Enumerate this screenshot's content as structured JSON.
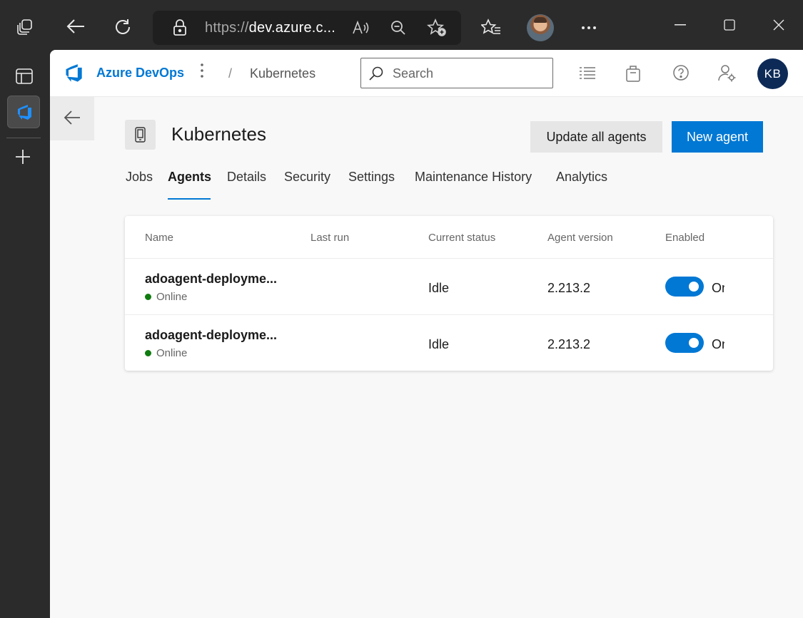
{
  "browser": {
    "url_prefix": "https://",
    "url_host": "dev.azure.c..."
  },
  "brand": {
    "name": "Azure DevOps",
    "color": "#0078d4"
  },
  "breadcrumb": {
    "separator": "/",
    "current": "Kubernetes"
  },
  "search": {
    "placeholder": "Search"
  },
  "user": {
    "initials": "KB"
  },
  "pool": {
    "title": "Kubernetes"
  },
  "actions": {
    "update_all": "Update all agents",
    "new_agent": "New agent"
  },
  "tabs": [
    {
      "label": "Jobs",
      "active": false
    },
    {
      "label": "Agents",
      "active": true
    },
    {
      "label": "Details",
      "active": false
    },
    {
      "label": "Security",
      "active": false
    },
    {
      "label": "Settings",
      "active": false
    },
    {
      "label": "Maintenance History",
      "active": false
    },
    {
      "label": "Analytics",
      "active": false
    }
  ],
  "table": {
    "columns": [
      "Name",
      "Last run",
      "Current status",
      "Agent version",
      "Enabled"
    ],
    "rows": [
      {
        "name": "adoagent-deployme...",
        "status": "Online",
        "last_run": "",
        "current_status": "Idle",
        "version": "2.213.2",
        "enabled": "On"
      },
      {
        "name": "adoagent-deployme...",
        "status": "Online",
        "last_run": "",
        "current_status": "Idle",
        "version": "2.213.2",
        "enabled": "On"
      }
    ]
  },
  "colors": {
    "accent": "#0078d4",
    "online": "#107c10",
    "avatar_bg": "#0d2a57"
  }
}
